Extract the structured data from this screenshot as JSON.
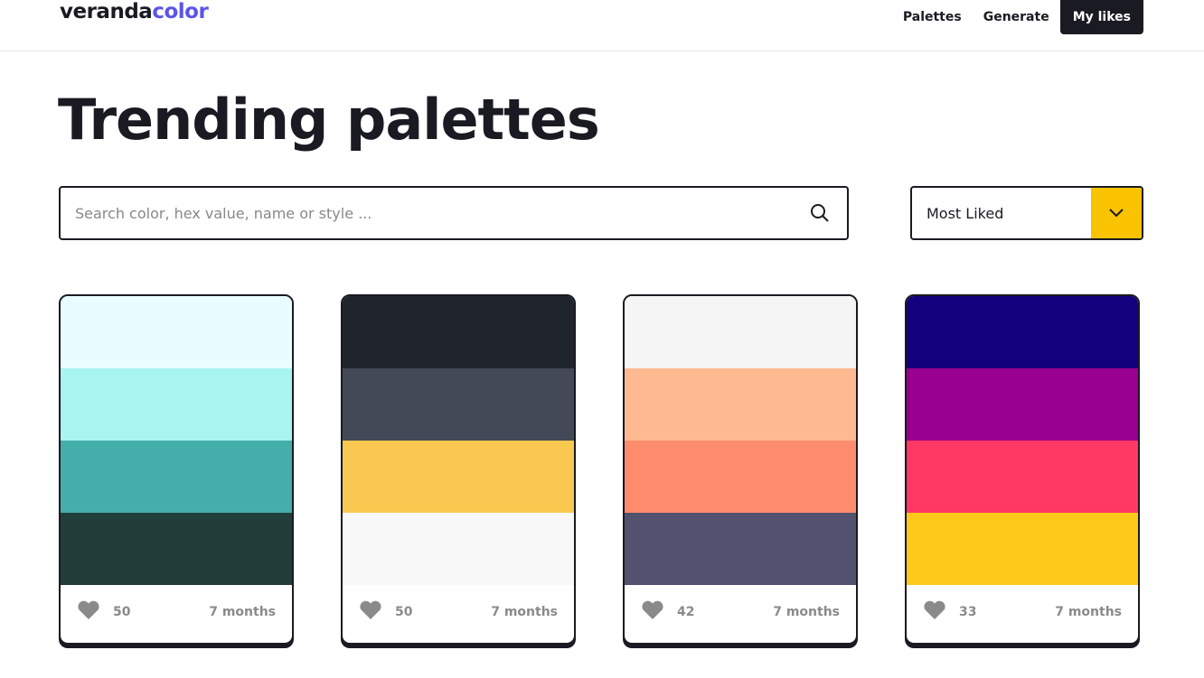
{
  "header": {
    "logo_part1": "veranda",
    "logo_part2": "color",
    "nav": [
      "Palettes",
      "Generate",
      "My likes"
    ]
  },
  "page_title": "Trending palettes",
  "search": {
    "placeholder": "Search color, hex value, name or style ...",
    "value": ""
  },
  "sort": {
    "selected": "Most Liked"
  },
  "palettes": [
    {
      "colors": [
        "#e8fdff",
        "#a8f4ef",
        "#43aeaa",
        "#223e3b"
      ],
      "likes": "50",
      "age": "7 months"
    },
    {
      "colors": [
        "#1f242d",
        "#434956",
        "#f9c850",
        "#f8f8f8"
      ],
      "likes": "50",
      "age": "7 months"
    },
    {
      "colors": [
        "#f5f5f5",
        "#ffb991",
        "#ff8c6d",
        "#52516f"
      ],
      "likes": "42",
      "age": "7 months"
    },
    {
      "colors": [
        "#13007c",
        "#9a0090",
        "#ff3864",
        "#fdca1b"
      ],
      "likes": "33",
      "age": "7 months"
    }
  ]
}
